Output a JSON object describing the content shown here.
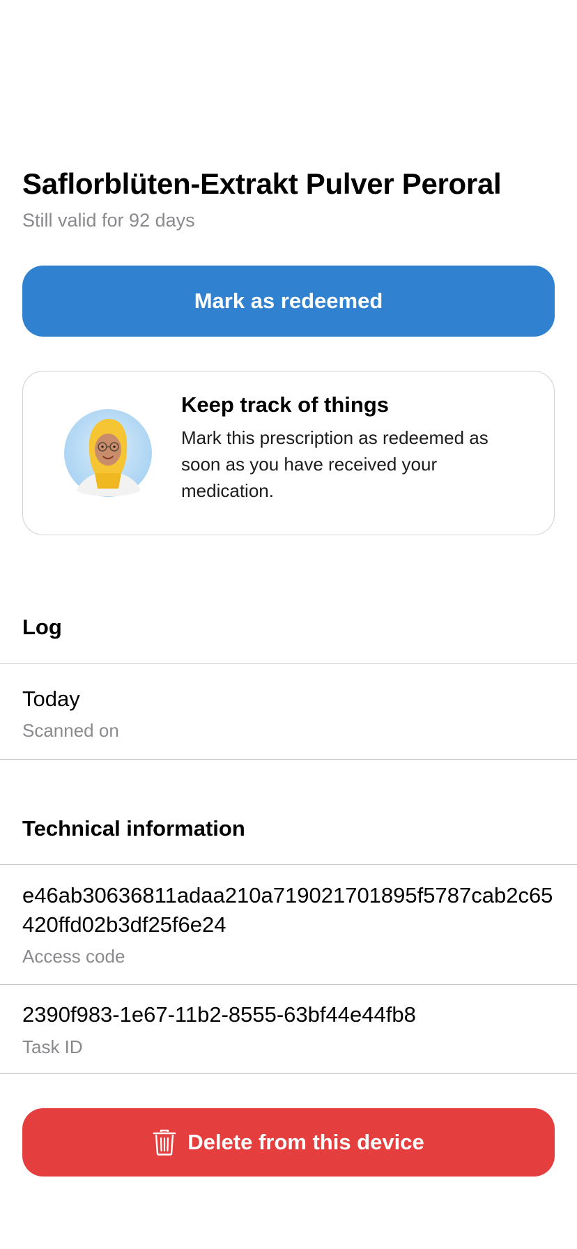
{
  "header": {
    "title": "Saflorblüten-Extrakt Pulver Peroral",
    "subtitle": "Still valid for 92 days"
  },
  "actions": {
    "redeem_label": "Mark as redeemed",
    "delete_label": "Delete from this device",
    "delete_icon": "trash-icon"
  },
  "hint_card": {
    "avatar": "pharmacist-avatar",
    "title": "Keep track of things",
    "body": "Mark this prescription as redeemed as soon as you have received your medication."
  },
  "log": {
    "header": "Log",
    "entries": [
      {
        "value": "Today",
        "label": "Scanned on"
      }
    ]
  },
  "technical": {
    "header": "Technical information",
    "items": [
      {
        "value": "e46ab30636811adaa210a719021701895f5787cab2c65420ffd02b3df25f6e24",
        "label": "Access code"
      },
      {
        "value": "2390f983-1e67-11b2-8555-63bf44e44fb8",
        "label": "Task ID"
      }
    ]
  },
  "colors": {
    "primary": "#3082d0",
    "danger": "#e53e3e",
    "secondary_text": "#8a8a8e"
  }
}
